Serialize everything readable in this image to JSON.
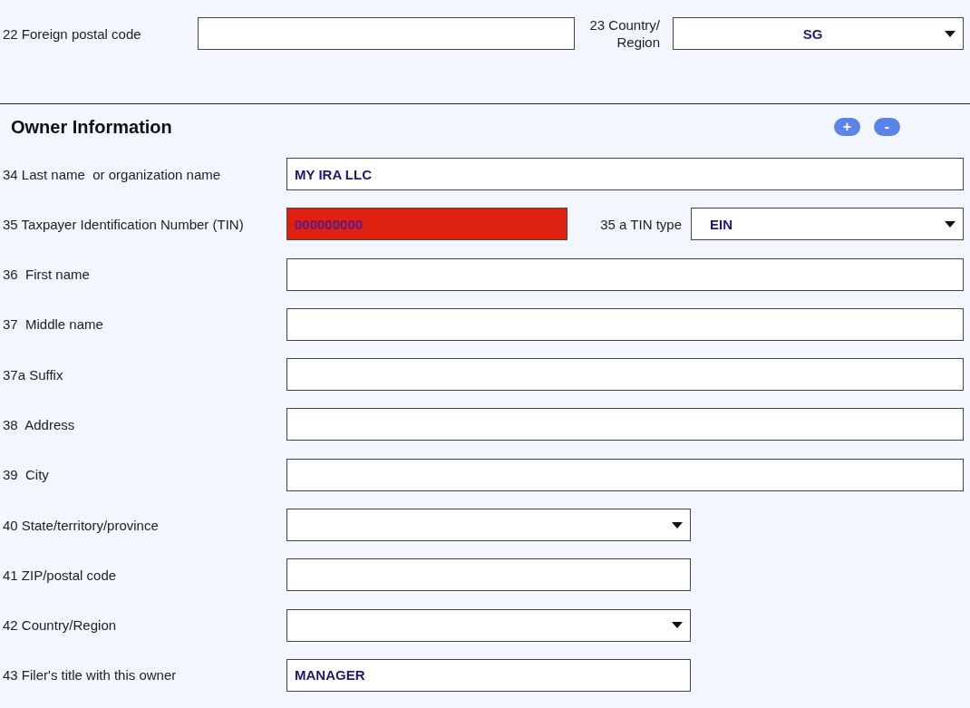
{
  "address": {
    "postal": {
      "label": "22 Foreign postal code"
    },
    "country": {
      "label": "23 Country/ Region",
      "value": "SG"
    }
  },
  "owner": {
    "title": "Owner Information",
    "add_button": "+",
    "remove_button": "-",
    "rows": [
      {
        "kind": "input",
        "label": "34 Last name  or organization name",
        "value": "MY IRA LLC"
      },
      {
        "kind": "tin",
        "label": "35 Taxpayer Identification Number (TIN)",
        "value": "000000000",
        "error": true,
        "type_label": "35 a TIN type",
        "type_value": "EIN"
      },
      {
        "kind": "input",
        "label": "36  First name"
      },
      {
        "kind": "input",
        "label": "37  Middle name"
      },
      {
        "kind": "input",
        "label": "37a Suffix"
      },
      {
        "kind": "input",
        "label": "38  Address"
      },
      {
        "kind": "input",
        "label": "39  City"
      }
    ],
    "short_rows": [
      {
        "kind": "select",
        "label": "40 State/territory/province"
      },
      {
        "kind": "input",
        "label": "41 ZIP/postal code"
      },
      {
        "kind": "select",
        "label": "42 Country/Region"
      },
      {
        "kind": "input",
        "label": "43 Filer's title with this owner",
        "value": "MANAGER"
      }
    ]
  }
}
